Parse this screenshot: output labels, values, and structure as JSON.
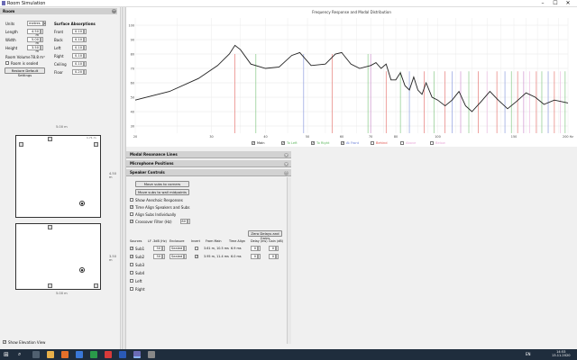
{
  "window": {
    "title": "Room Simulation"
  },
  "room_panel": {
    "header": "Room",
    "units_label": "Units",
    "units_value": "metres",
    "length_label": "Length",
    "length_value": "4.50 m",
    "width_label": "Width",
    "width_value": "5.00 m",
    "height_label": "Height",
    "height_value": "3.50 m",
    "volume_label": "Room Volume",
    "volume_value": "78.8 m³",
    "sealed_label": "Room is sealed",
    "restore_label": "Restore Default Settings",
    "absorption_header": "Surface Absorptions",
    "surfaces": [
      {
        "label": "Front",
        "value": "0.10"
      },
      {
        "label": "Back",
        "value": "0.10"
      },
      {
        "label": "Left",
        "value": "0.10"
      },
      {
        "label": "Right",
        "value": "0.10"
      },
      {
        "label": "Ceiling",
        "value": "0.10"
      },
      {
        "label": "Floor",
        "value": "0.20"
      }
    ]
  },
  "plan_view": {
    "top_room_width_label": "5.00 m",
    "top_room_side_label": "4.50 m",
    "top_room_small_label": "1.71 m",
    "bottom_room_width_label": "5.00 m",
    "bottom_room_side_label": "3.50 m",
    "show_elevation_label": "Show Elevation View"
  },
  "graph": {
    "title": "Frequency Response and Modal Distribution",
    "y_ticks": [
      "100",
      "90",
      "80",
      "70",
      "60",
      "50",
      "40",
      "30"
    ],
    "x_ticks": [
      "20",
      "30",
      "40",
      "50",
      "60",
      "70",
      "80",
      "100",
      "150",
      "200 Hz"
    ],
    "legend": [
      "Main",
      "To Left",
      "To Right",
      "At Front",
      "Behind",
      "Above",
      "Below"
    ],
    "colors": {
      "main": "#222222",
      "mode_red": "#e0504a",
      "mode_green": "#5fb85f",
      "mode_blue": "#6a7fd6",
      "mode_purple": "#c070c0",
      "mode_pink": "#e8a8d8"
    }
  },
  "sections": {
    "modal_resonance": "Modal Resonance Lines",
    "mic_positions": "Microphone Positions",
    "speaker_controls": "Speaker Controls"
  },
  "speaker_controls": {
    "move_corners": "Move subs to corners",
    "move_midpoints": "Move subs to wall midpoints",
    "show_anechoic": "Show Anechoic Responses",
    "time_align": "Time Align Speakers and Subs",
    "align_subs": "Align Subs Individually",
    "crossover_label": "Crossover Filter (Hz)",
    "crossover_value": "80",
    "zero_delays": "Zero Delays and Gains",
    "columns": [
      "Sources",
      "LF -3dB (Hz)",
      "Enclosure",
      "Invert",
      "From Main",
      "Time Align",
      "Delay (ms)",
      "Gain (dB)"
    ],
    "sources": [
      {
        "name": "Sub1",
        "lf": "30",
        "enclosure": "Sealed",
        "from_main": "3.61 m, 10.5 ms",
        "time_align": "6.9 ms",
        "delay": "0",
        "gain": "0"
      },
      {
        "name": "Sub2",
        "lf": "30",
        "enclosure": "Sealed",
        "from_main": "3.95 m, 11.4 ms",
        "time_align": "6.0 ms",
        "delay": "0",
        "gain": "0"
      }
    ],
    "other_sources": [
      "Sub3",
      "Sub4",
      "Left",
      "Right"
    ]
  },
  "taskbar": {
    "time": "14:53",
    "date": "13.11.2020",
    "locale": "EN"
  }
}
